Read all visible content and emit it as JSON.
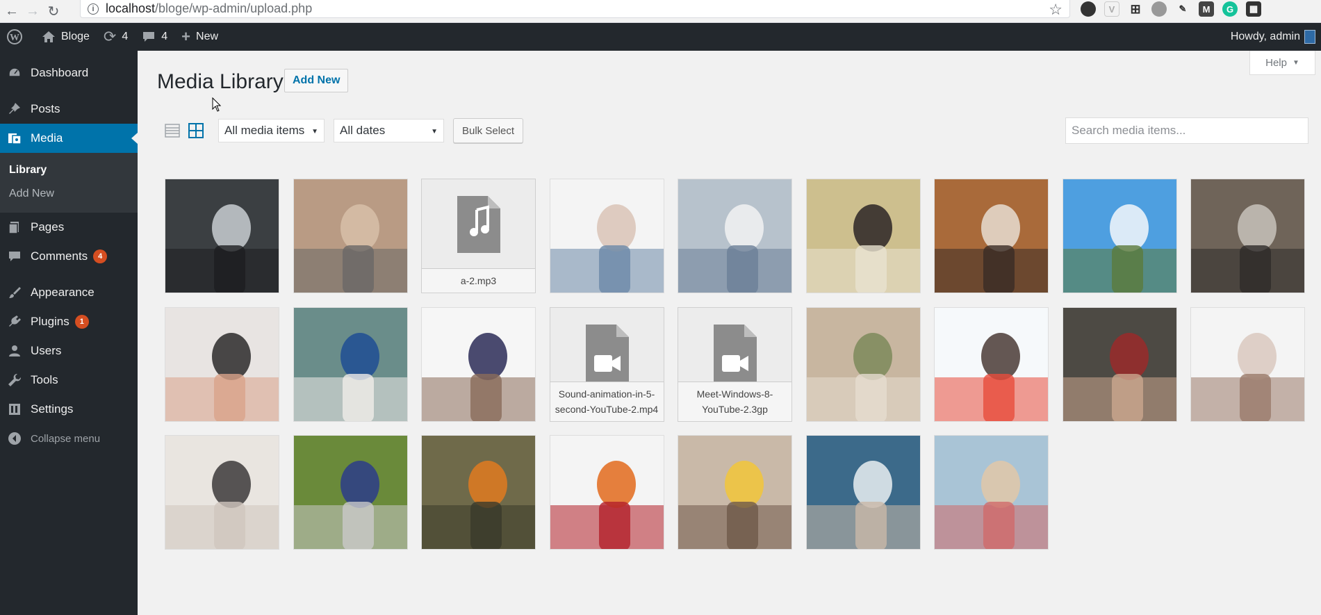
{
  "browser": {
    "url_host": "localhost",
    "url_path": "/bloge/wp-admin/upload.php"
  },
  "adminbar": {
    "site_name": "Bloge",
    "updates_count": "4",
    "comments_count": "4",
    "new_label": "New",
    "howdy": "Howdy, admin"
  },
  "sidebar": {
    "items": [
      {
        "label": "Dashboard",
        "icon": "dashboard-icon"
      },
      {
        "label": "Posts",
        "icon": "pin-icon"
      },
      {
        "label": "Media",
        "icon": "media-icon"
      },
      {
        "label": "Pages",
        "icon": "pages-icon"
      },
      {
        "label": "Comments",
        "icon": "comments-icon",
        "badge": "4"
      },
      {
        "label": "Appearance",
        "icon": "brush-icon"
      },
      {
        "label": "Plugins",
        "icon": "plugin-icon",
        "badge": "1"
      },
      {
        "label": "Users",
        "icon": "user-icon"
      },
      {
        "label": "Tools",
        "icon": "wrench-icon"
      },
      {
        "label": "Settings",
        "icon": "settings-icon"
      }
    ],
    "submenu": [
      "Library",
      "Add New"
    ],
    "collapse_label": "Collapse menu"
  },
  "help_label": "Help",
  "page_title": "Media Library",
  "add_new_label": "Add New",
  "filters": {
    "type_selected": "All media items",
    "date_selected": "All dates"
  },
  "bulk_select_label": "Bulk Select",
  "search_placeholder": "Search media items...",
  "media": [
    {
      "kind": "image",
      "colors": [
        "#3b3f42",
        "#c9ced1",
        "#1d1e20"
      ]
    },
    {
      "kind": "image",
      "colors": [
        "#b99b84",
        "#d7bfa8",
        "#6a6866"
      ]
    },
    {
      "kind": "audio",
      "filename": "a-2.mp3"
    },
    {
      "kind": "image",
      "colors": [
        "#f4f4f4",
        "#d9c3b6",
        "#6b88a8"
      ]
    },
    {
      "kind": "image",
      "colors": [
        "#b7c2cc",
        "#f2f2f2",
        "#6c7f97"
      ]
    },
    {
      "kind": "image",
      "colors": [
        "#cdbf8e",
        "#2b2426",
        "#e9e2cf"
      ]
    },
    {
      "kind": "image",
      "colors": [
        "#a96a3a",
        "#e7ddd2",
        "#3a2c26"
      ]
    },
    {
      "kind": "image",
      "colors": [
        "#4e9fe0",
        "#f4f7fa",
        "#5b7a3b"
      ]
    },
    {
      "kind": "image",
      "colors": [
        "#6f6459",
        "#c8c2bb",
        "#2e2b29"
      ]
    },
    {
      "kind": "image",
      "colors": [
        "#e8e4e2",
        "#2c2a2a",
        "#d9a38a"
      ]
    },
    {
      "kind": "image",
      "colors": [
        "#6a8d8a",
        "#1f4d93",
        "#f0ece9"
      ]
    },
    {
      "kind": "image",
      "colors": [
        "#f6f6f6",
        "#2b2b57",
        "#8a6b5a"
      ]
    },
    {
      "kind": "video",
      "filename": "Sound-animation-in-5-second-YouTube-2.mp4"
    },
    {
      "kind": "video",
      "filename": "Meet-Windows-8-YouTube-2.3gp"
    },
    {
      "kind": "image",
      "colors": [
        "#c8b6a0",
        "#7d8a5a",
        "#e6dccf"
      ]
    },
    {
      "kind": "image",
      "colors": [
        "#f6f9fb",
        "#4a3b35",
        "#e74c3c"
      ]
    },
    {
      "kind": "image",
      "colors": [
        "#4d4a44",
        "#9a2a2a",
        "#caa68e"
      ]
    },
    {
      "kind": "image",
      "colors": [
        "#f4f4f4",
        "#d9c8be",
        "#9a7a6a"
      ]
    },
    {
      "kind": "image",
      "colors": [
        "#e9e5e0",
        "#3c3a3a",
        "#cfc6be"
      ]
    },
    {
      "kind": "image",
      "colors": [
        "#6a8a3a",
        "#2b3c8a",
        "#c9c9c9"
      ]
    },
    {
      "kind": "image",
      "colors": [
        "#6f6a4a",
        "#e07a20",
        "#3a3a2a"
      ]
    },
    {
      "kind": "image",
      "colors": [
        "#f4f4f4",
        "#e26a1c",
        "#b3202a"
      ]
    },
    {
      "kind": "image",
      "colors": [
        "#c9b9a8",
        "#f2c63a",
        "#6f5a4a"
      ]
    },
    {
      "kind": "image",
      "colors": [
        "#3c6a8a",
        "#e9eef1",
        "#c9b8a8"
      ]
    },
    {
      "kind": "image",
      "colors": [
        "#a9c4d6",
        "#e2c8a8",
        "#d06a6a"
      ]
    }
  ]
}
